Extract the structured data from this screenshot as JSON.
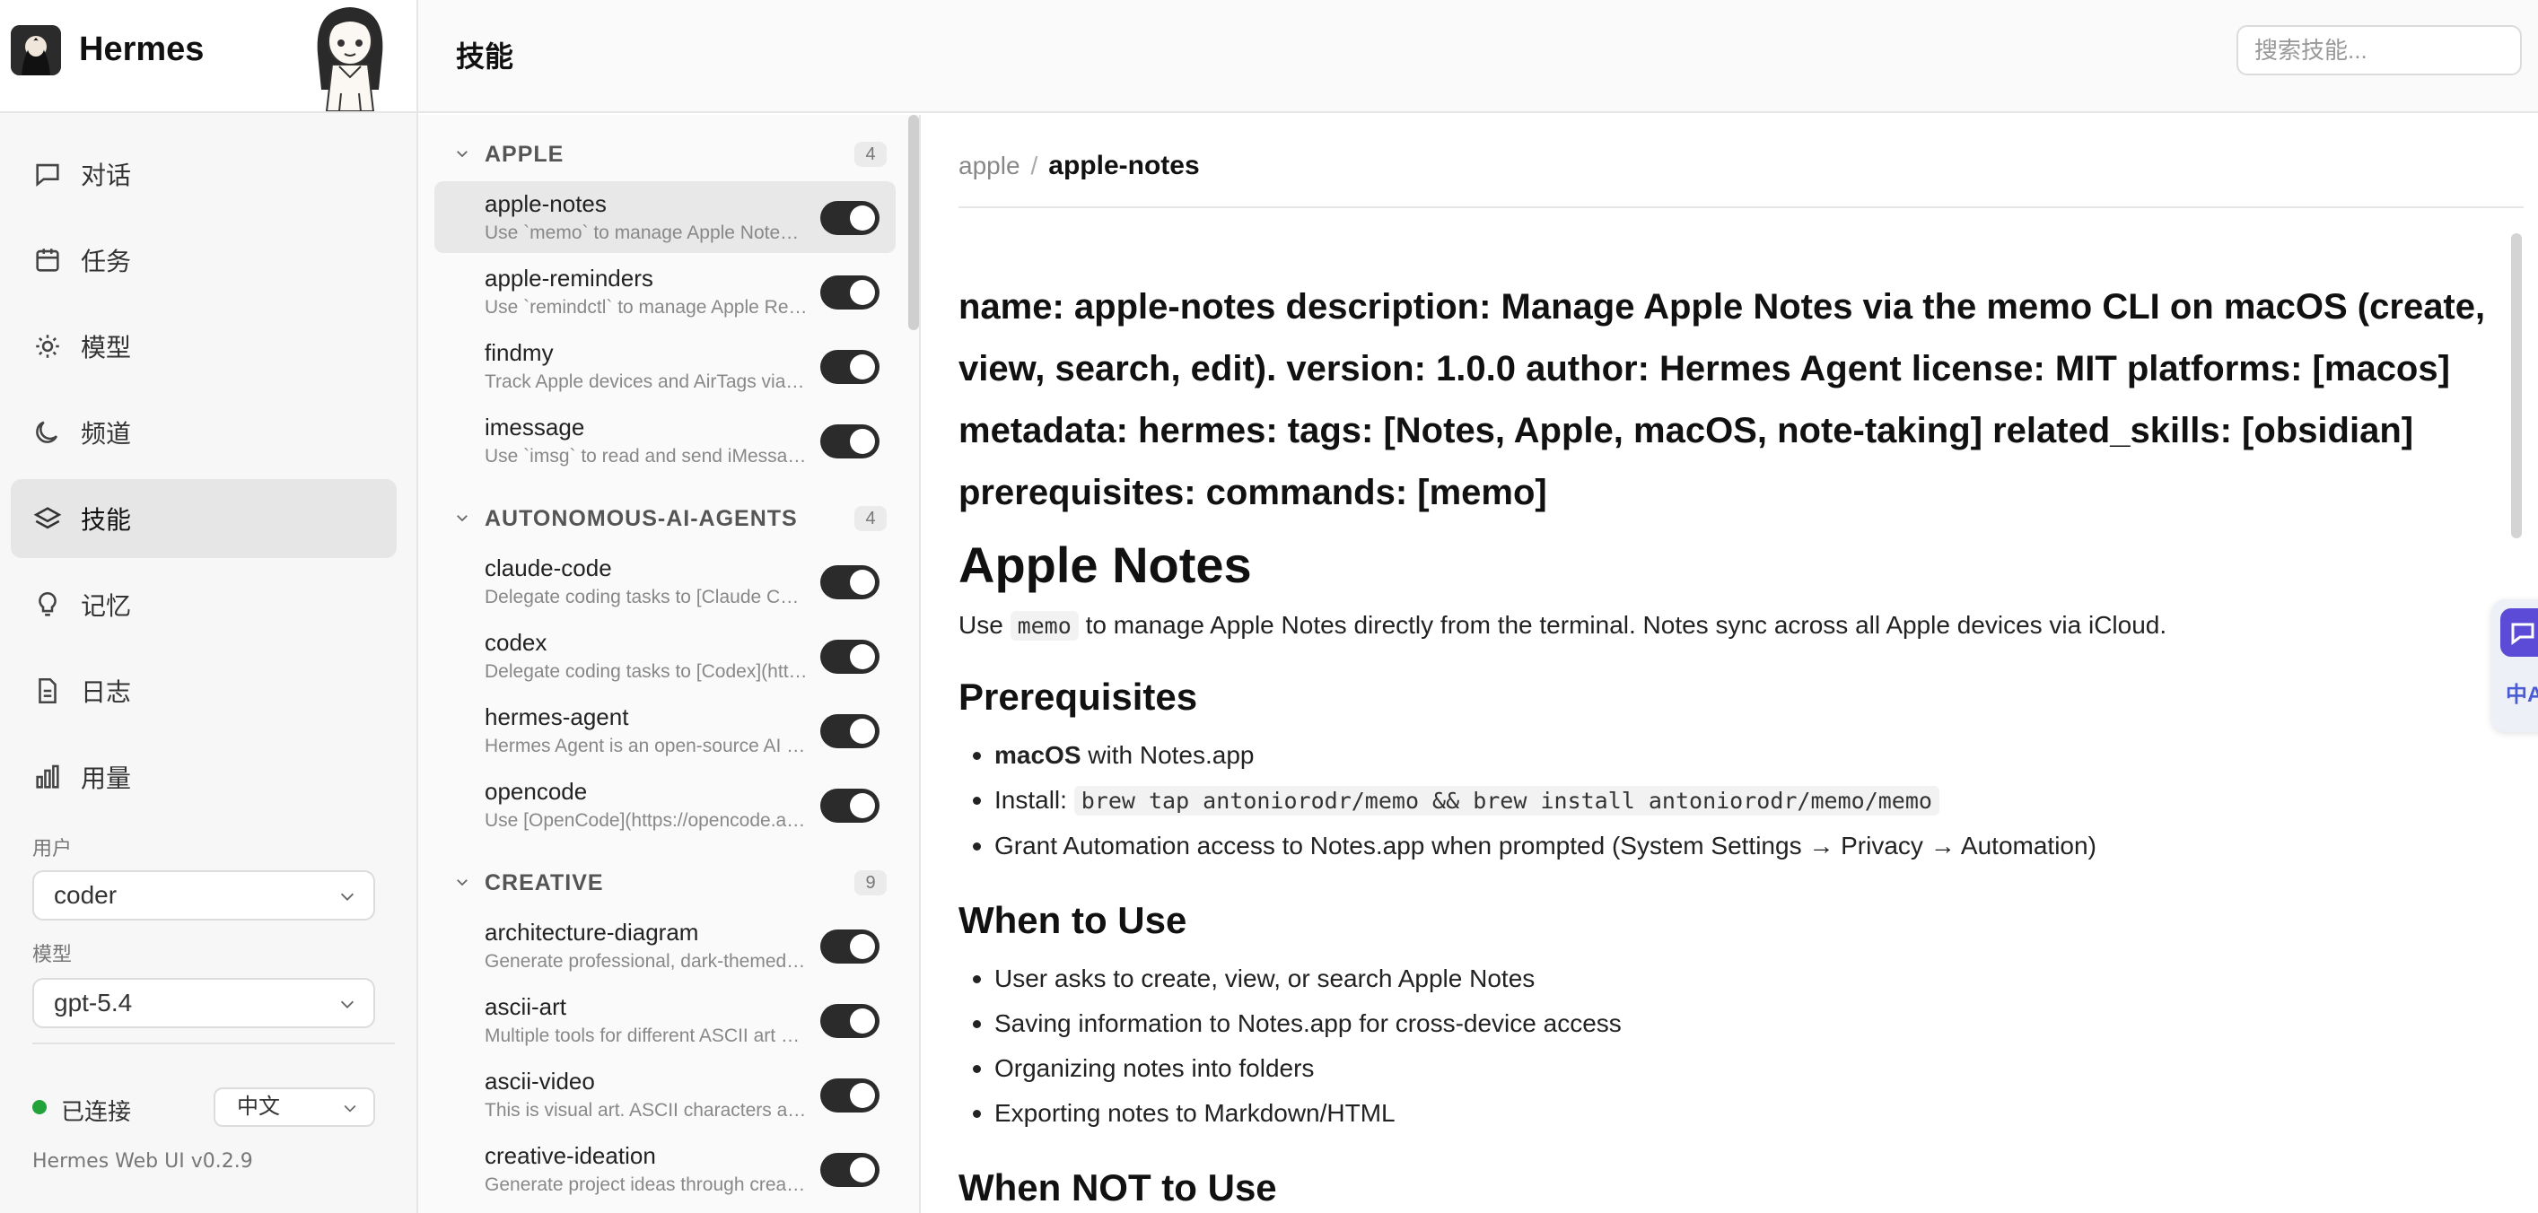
{
  "app": {
    "name": "Hermes",
    "version": "Hermes Web UI v0.2.9"
  },
  "header": {
    "title": "技能",
    "search_placeholder": "搜索技能..."
  },
  "sidebar": {
    "nav": [
      {
        "label": "对话",
        "icon": "chat-bubble-icon"
      },
      {
        "label": "任务",
        "icon": "calendar-icon"
      },
      {
        "label": "模型",
        "icon": "sun-icon"
      },
      {
        "label": "频道",
        "icon": "moon-icon"
      },
      {
        "label": "技能",
        "icon": "layers-icon",
        "active": true
      },
      {
        "label": "记忆",
        "icon": "lightbulb-icon"
      },
      {
        "label": "日志",
        "icon": "document-icon"
      },
      {
        "label": "用量",
        "icon": "bar-chart-icon"
      }
    ],
    "user_label": "用户",
    "user_value": "coder",
    "model_label": "模型",
    "model_value": "gpt-5.4",
    "status": "已连接",
    "status_color": "#22a33a",
    "language": "中文"
  },
  "skills": {
    "categories": [
      {
        "name": "APPLE",
        "count": "4",
        "items": [
          {
            "name": "apple-notes",
            "desc": "Use `memo` to manage Apple Notes directly from the terminal.",
            "enabled": true,
            "active": true
          },
          {
            "name": "apple-reminders",
            "desc": "Use `remindctl` to manage Apple Reminders directly from the terminal.",
            "enabled": true
          },
          {
            "name": "findmy",
            "desc": "Track Apple devices and AirTags via FindMy.app on macOS.",
            "enabled": true
          },
          {
            "name": "imessage",
            "desc": "Use `imsg` to read and send iMessage/SMS via macOS Messages.",
            "enabled": true
          }
        ]
      },
      {
        "name": "AUTONOMOUS-AI-AGENTS",
        "count": "4",
        "items": [
          {
            "name": "claude-code",
            "desc": "Delegate coding tasks to [Claude Code](https://docs.anthropic.com)",
            "enabled": true
          },
          {
            "name": "codex",
            "desc": "Delegate coding tasks to [Codex](https://github.com/openai/codex)",
            "enabled": true
          },
          {
            "name": "hermes-agent",
            "desc": "Hermes Agent is an open-source AI agent framework",
            "enabled": true
          },
          {
            "name": "opencode",
            "desc": "Use [OpenCode](https://opencode.ai) as an autonomous coding worker",
            "enabled": true
          }
        ]
      },
      {
        "name": "CREATIVE",
        "count": "9",
        "items": [
          {
            "name": "architecture-diagram",
            "desc": "Generate professional, dark-themed architecture diagrams",
            "enabled": true
          },
          {
            "name": "ascii-art",
            "desc": "Multiple tools for different ASCII art needs",
            "enabled": true
          },
          {
            "name": "ascii-video",
            "desc": "This is visual art. ASCII characters are the medium",
            "enabled": true
          },
          {
            "name": "creative-ideation",
            "desc": "Generate project ideas through creative constraints",
            "enabled": true
          }
        ]
      }
    ]
  },
  "content": {
    "breadcrumb_parent": "apple",
    "breadcrumb_sep": "/",
    "breadcrumb_current": "apple-notes",
    "meta": "name: apple-notes description: Manage Apple Notes via the memo CLI on macOS (create, view, search, edit). version: 1.0.0 author: Hermes Agent license: MIT platforms: [macos] metadata: hermes: tags: [Notes, Apple, macOS, note-taking] related_skills: [obsidian] prerequisites: commands: [memo]",
    "title": "Apple Notes",
    "intro_pre": "Use",
    "intro_code": "memo",
    "intro_post": "to manage Apple Notes directly from the terminal. Notes sync across all Apple devices via iCloud.",
    "prereq_heading": "Prerequisites",
    "prereq_1_bold": "macOS",
    "prereq_1_rest": " with Notes.app",
    "prereq_2_label": "Install:",
    "prereq_2_code": "brew tap antoniorodr/memo && brew install antoniorodr/memo/memo",
    "prereq_3": "Grant Automation access to Notes.app when prompted (System Settings → Privacy → Automation)",
    "when_heading": "When to Use",
    "when_items": [
      "User asks to create, view, or search Apple Notes",
      "Saving information to Notes.app for cross-device access",
      "Organizing notes into folders",
      "Exporting notes to Markdown/HTML"
    ],
    "when_not_heading": "When NOT to Use"
  },
  "floating": {
    "translate_label": "中A"
  }
}
